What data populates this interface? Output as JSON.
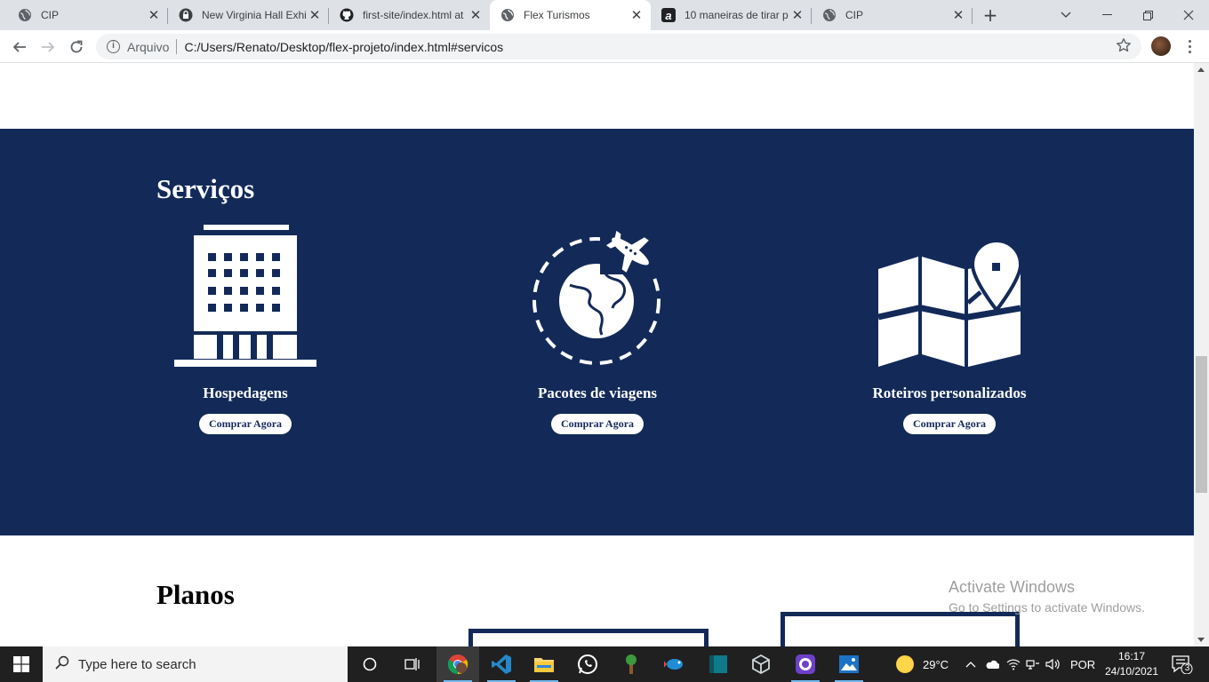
{
  "browser": {
    "tabs": [
      {
        "title": "CIP",
        "icon": "globe-icon",
        "active": false
      },
      {
        "title": "New Virginia Hall Exhi",
        "icon": "lock-icon",
        "active": false
      },
      {
        "title": "first-site/index.html at",
        "icon": "github-icon",
        "active": false
      },
      {
        "title": "Flex Turismos",
        "icon": "globe-icon",
        "active": true
      },
      {
        "title": "10 maneiras de tirar p",
        "icon": "a-logo-icon",
        "active": false
      },
      {
        "title": "CIP",
        "icon": "globe-icon",
        "active": false
      }
    ],
    "omnibox": {
      "label": "Arquivo",
      "url": "C:/Users/Renato/Desktop/flex-projeto/index.html#servicos"
    }
  },
  "page": {
    "servicos": {
      "heading": "Serviços",
      "background": "#132a59",
      "items": [
        {
          "label": "Hospedagens",
          "button": "Comprar Agora",
          "icon": "hotel-building-icon"
        },
        {
          "label": "Pacotes de viagens",
          "button": "Comprar Agora",
          "icon": "globe-airplane-icon"
        },
        {
          "label": "Roteiros personalizados",
          "button": "Comprar Agora",
          "icon": "map-pin-icon"
        }
      ]
    },
    "planos": {
      "heading": "Planos"
    }
  },
  "watermark": {
    "line1": "Activate Windows",
    "line2": "Go to Settings to activate Windows."
  },
  "taskbar": {
    "search_placeholder": "Type here to search",
    "weather": "29°C",
    "language": "POR",
    "time": "16:17",
    "date": "24/10/2021",
    "notifications": "3"
  }
}
